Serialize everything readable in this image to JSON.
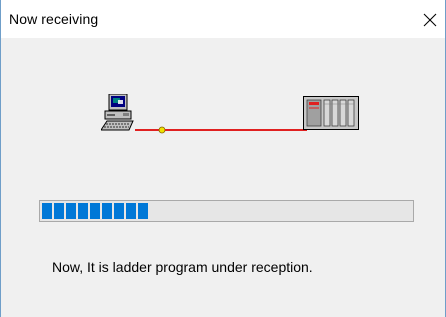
{
  "window": {
    "title": "Now receiving"
  },
  "close_button": {
    "label": "×"
  },
  "transfer": {
    "source_icon": "computer-icon",
    "target_icon": "plc-icon",
    "link_color": "#e02020",
    "endpoint_color": "#f0e000"
  },
  "progress": {
    "fraction": 0.35,
    "blocks_filled": 9,
    "accent_color": "#0078d7"
  },
  "status": {
    "message": "Now, It is ladder program under reception."
  }
}
